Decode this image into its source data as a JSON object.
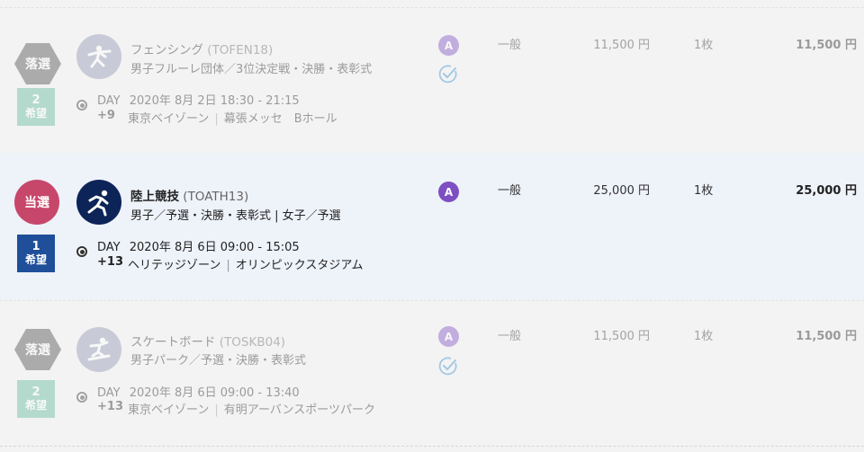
{
  "rows": [
    {
      "result": "落選",
      "preference": {
        "num": "2",
        "label": "希望"
      },
      "sport": "フェンシング",
      "code": "(TOFEN18)",
      "detail": "男子フルーレ団体／3位決定戦・決勝・表彰式",
      "day_label": "DAY",
      "day_num": "+9",
      "datetime": "2020年 8月 2日 18:30 - 21:15",
      "zone": "東京ベイゾーン",
      "venue": "幕張メッセ　Bホール",
      "category": "A",
      "seat_type": "一般",
      "unit_price": "11,500 円",
      "quantity": "1枚",
      "total": "11,500 円"
    },
    {
      "result": "当選",
      "preference": {
        "num": "1",
        "label": "希望"
      },
      "sport": "陸上競技",
      "code": "(TOATH13)",
      "detail": "男子／予選・決勝・表彰式 | 女子／予選",
      "day_label": "DAY",
      "day_num": "+13",
      "datetime": "2020年 8月 6日 09:00 - 15:05",
      "zone": "ヘリテッジゾーン",
      "venue": "オリンピックスタジアム",
      "category": "A",
      "seat_type": "一般",
      "unit_price": "25,000 円",
      "quantity": "1枚",
      "total": "25,000 円"
    },
    {
      "result": "落選",
      "preference": {
        "num": "2",
        "label": "希望"
      },
      "sport": "スケートボード",
      "code": "(TOSKB04)",
      "detail": "男子パーク／予選・決勝・表彰式",
      "day_label": "DAY",
      "day_num": "+13",
      "datetime": "2020年 8月 6日 09:00 - 13:40",
      "zone": "東京ベイゾーン",
      "venue": "有明アーバンスポーツパーク",
      "category": "A",
      "seat_type": "一般",
      "unit_price": "11,500 円",
      "quantity": "1枚",
      "total": "11,500 円"
    }
  ],
  "separator": "|",
  "colors": {
    "lost_badge": "#4a4a4a",
    "won_badge": "#c7476b",
    "pref_teal": "#5fb89b",
    "pref_blue": "#1f4f99",
    "category_purple": "#7d4fc2",
    "highlight_row": "#eef2f9"
  },
  "icons": {
    "fencing": "fencing-pictogram-icon",
    "athletics": "athletics-pictogram-icon",
    "skateboard": "skateboard-pictogram-icon",
    "confirmed": "check-circle-icon"
  }
}
